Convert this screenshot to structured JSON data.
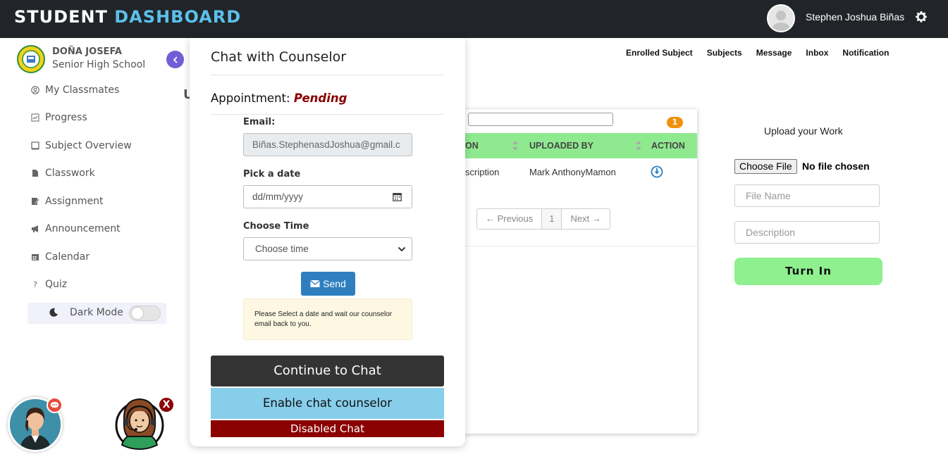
{
  "header": {
    "brand_part1": "STUDENT",
    "brand_part2": "DASHBOARD",
    "user_name": "Stephen Joshua Biñas"
  },
  "sidebar": {
    "school_line1": "DOÑA JOSEFA",
    "school_line2": "Senior High School",
    "items": [
      {
        "label": "My Classmates",
        "icon": "user-circle-icon"
      },
      {
        "label": "Progress",
        "icon": "chart-icon"
      },
      {
        "label": "Subject Overview",
        "icon": "square-icon"
      },
      {
        "label": "Classwork",
        "icon": "file-icon"
      },
      {
        "label": "Assignment",
        "icon": "edit-icon"
      },
      {
        "label": "Announcement",
        "icon": "megaphone-icon"
      },
      {
        "label": "Calendar",
        "icon": "calendar-icon"
      },
      {
        "label": "Quiz",
        "icon": "question-icon"
      }
    ],
    "dark_mode_label": "Dark Mode",
    "dark_mode_on": false
  },
  "topnav": [
    "Enrolled Subject",
    "Subjects",
    "Message",
    "Inbox",
    "Notification"
  ],
  "page_letter": "U",
  "table": {
    "badge_count": "1",
    "headers": [
      "ON",
      "UPLOADED BY",
      "ACTION"
    ],
    "row": {
      "description": "scription",
      "uploaded_by": "Mark AnthonyMamon"
    },
    "pager": {
      "prev": "← Previous",
      "page": "1",
      "next": "Next →"
    }
  },
  "upload": {
    "title": "Upload your Work",
    "choose_file": "Choose File",
    "no_file": "No file chosen",
    "file_name_placeholder": "File Name",
    "description_placeholder": "Description",
    "turn_in": "Turn In"
  },
  "modal": {
    "title": "Chat with Counselor",
    "appointment_label": "Appointment:",
    "appointment_status": "Pending",
    "email_label": "Email:",
    "email_value": "Biñas.StephenasdJoshua@gmail.c",
    "date_label": "Pick a date",
    "date_placeholder": "dd/mm/yyyy",
    "time_label": "Choose Time",
    "time_value": "Choose time",
    "send_label": "Send",
    "note": "Please Select a date  and wait our counselor email back to you.",
    "continue_label": "Continue to Chat",
    "enable_label": "Enable chat counselor",
    "disabled_label": "Disabled Chat"
  },
  "floating": {
    "close_label": "X"
  },
  "colors": {
    "topbar": "#212529",
    "brand_accent": "#5bc0eb",
    "table_header": "#8fe98f",
    "turn_in": "#8ef08e",
    "status": "#8b0000",
    "send": "#2f7fc0",
    "enable": "#87ceeb",
    "disabled": "#8b0000"
  }
}
